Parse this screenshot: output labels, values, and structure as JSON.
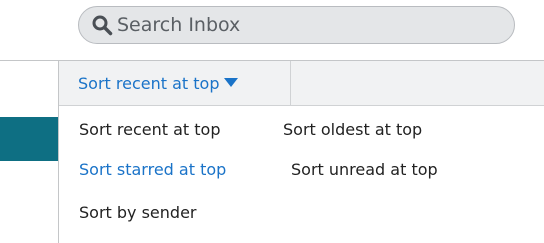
{
  "search": {
    "placeholder": "Search Inbox",
    "icon": "search-icon"
  },
  "sort": {
    "current_label": "Sort recent at top",
    "caret_icon": "caret-down-icon",
    "options": [
      {
        "label": "Sort recent at top",
        "selected": false
      },
      {
        "label": "Sort oldest at top",
        "selected": false
      },
      {
        "label": "Sort starred at top",
        "selected": true
      },
      {
        "label": "Sort unread at top",
        "selected": false
      },
      {
        "label": "Sort by sender",
        "selected": false
      }
    ]
  },
  "colors": {
    "accent": "#1a73c8",
    "side_band": "#0e6f83"
  }
}
